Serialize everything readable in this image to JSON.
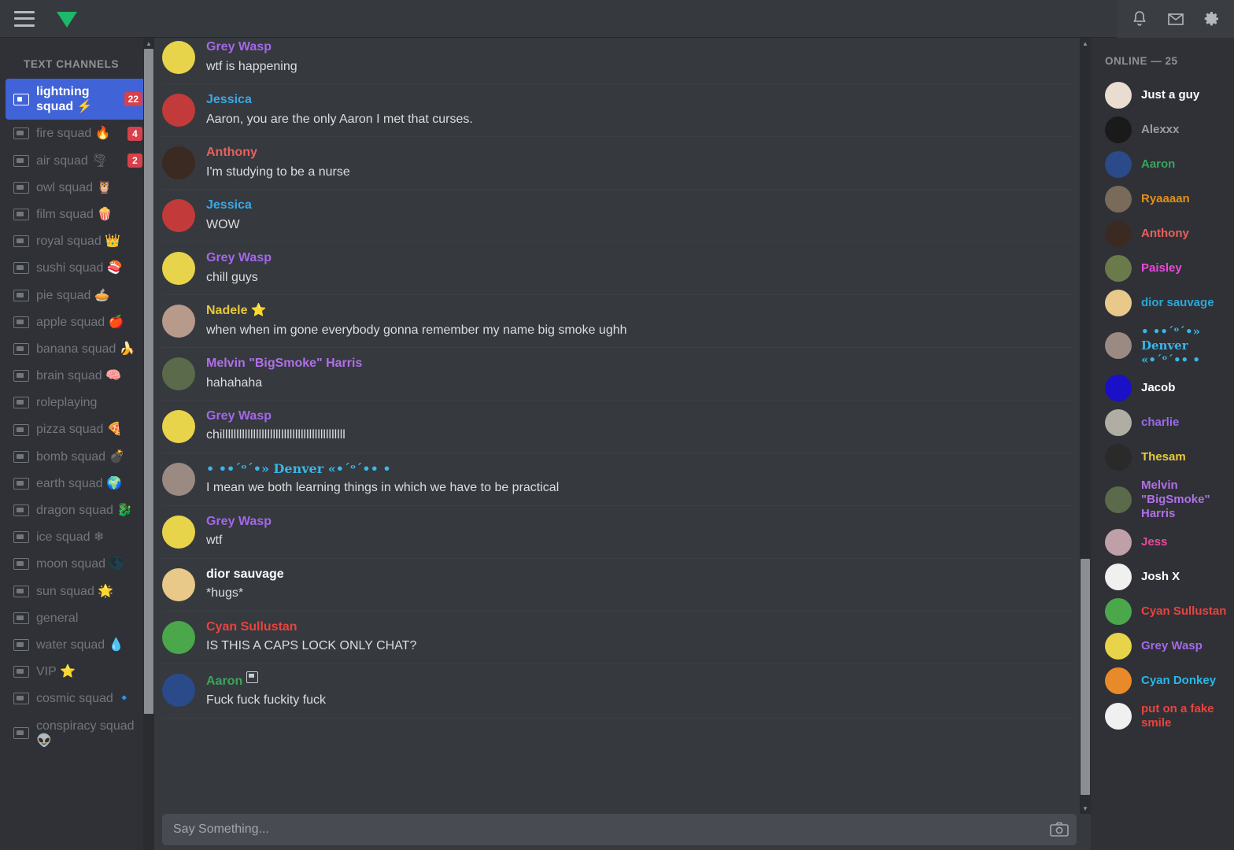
{
  "topbar": {
    "menu_icon": "hamburger-menu-icon",
    "logo_icon": "green-gem-logo",
    "notifications_icon": "bell-icon",
    "mail_icon": "envelope-icon",
    "settings_icon": "gear-icon"
  },
  "sidebar": {
    "title": "TEXT CHANNELS",
    "channels": [
      {
        "label": "lightning squad ⚡",
        "badge": "22",
        "active": true
      },
      {
        "label": "fire squad 🔥",
        "badge": "4",
        "active": false
      },
      {
        "label": "air squad 🌪",
        "badge": "2",
        "active": false
      },
      {
        "label": "owl squad 🦉",
        "badge": "",
        "active": false
      },
      {
        "label": "film squad 🍿",
        "badge": "",
        "active": false
      },
      {
        "label": "royal squad 👑",
        "badge": "",
        "active": false
      },
      {
        "label": "sushi squad 🍣",
        "badge": "",
        "active": false
      },
      {
        "label": "pie squad 🥧",
        "badge": "",
        "active": false
      },
      {
        "label": "apple squad 🍎",
        "badge": "",
        "active": false
      },
      {
        "label": "banana squad 🍌",
        "badge": "",
        "active": false
      },
      {
        "label": "brain squad 🧠",
        "badge": "",
        "active": false
      },
      {
        "label": "roleplaying",
        "badge": "",
        "active": false
      },
      {
        "label": "pizza squad 🍕",
        "badge": "",
        "active": false
      },
      {
        "label": "bomb squad 💣",
        "badge": "",
        "active": false
      },
      {
        "label": "earth squad 🌍",
        "badge": "",
        "active": false
      },
      {
        "label": "dragon squad 🐉",
        "badge": "",
        "active": false
      },
      {
        "label": "ice squad ❄",
        "badge": "",
        "active": false
      },
      {
        "label": "moon squad 🌑",
        "badge": "",
        "active": false
      },
      {
        "label": "sun squad 🌟",
        "badge": "",
        "active": false
      },
      {
        "label": "general",
        "badge": "",
        "active": false
      },
      {
        "label": "water squad 💧",
        "badge": "",
        "active": false
      },
      {
        "label": "VIP ⭐",
        "badge": "",
        "active": false
      },
      {
        "label": "cosmic squad 🔹",
        "badge": "",
        "active": false
      },
      {
        "label": "conspiracy squad 👽",
        "badge": "",
        "active": false
      }
    ]
  },
  "chat": {
    "messages": [
      {
        "user": "Grey Wasp",
        "color": "#a368e8",
        "text": "wtf is happening",
        "avatar": "#e8d44a",
        "badge": ""
      },
      {
        "user": "Jessica",
        "color": "#3aa8e8",
        "text": "Aaron, you are the only Aaron I met that curses.",
        "avatar": "#c23a3a",
        "badge": ""
      },
      {
        "user": "Anthony",
        "color": "#e8615c",
        "text": "I'm studying to be a nurse",
        "avatar": "#3a2a22",
        "badge": ""
      },
      {
        "user": "Jessica",
        "color": "#3aa8e8",
        "text": "WOW",
        "avatar": "#c23a3a",
        "badge": ""
      },
      {
        "user": "Grey Wasp",
        "color": "#a368e8",
        "text": "chill guys",
        "avatar": "#e8d44a",
        "badge": ""
      },
      {
        "user": "Nadele ⭐",
        "color": "#e8c93a",
        "text": "when when im gone everybody gonna remember my name big smoke ughh",
        "avatar": "#b79a8a",
        "badge": ""
      },
      {
        "user": "Melvin \"BigSmoke\" Harris",
        "color": "#b06fe8",
        "text": "hahahaha",
        "avatar": "#5a6a4a",
        "badge": ""
      },
      {
        "user": "Grey Wasp",
        "color": "#a368e8",
        "text": "chillllllllllllllllllllllllllllllllllllllllllll",
        "avatar": "#e8d44a",
        "badge": ""
      },
      {
        "user": "• ••ˊᵒˊ•» Denver «•ˊᵒˊ•• •",
        "color": "#3ab6e8",
        "text": "I mean we both learning things in which we have to be practical",
        "avatar": "#9a8a82",
        "badge": ""
      },
      {
        "user": "Grey Wasp",
        "color": "#a368e8",
        "text": "wtf",
        "avatar": "#e8d44a",
        "badge": ""
      },
      {
        "user": "dior sauvage",
        "color": "#ffffff",
        "text": "*hugs*",
        "avatar": "#e8c98a",
        "badge": ""
      },
      {
        "user": "Cyan Sullustan",
        "color": "#e8443f",
        "text": "IS THIS A CAPS LOCK ONLY CHAT?",
        "avatar": "#4aa84a",
        "badge": ""
      },
      {
        "user": "Aaron",
        "color": "#3ba55c",
        "text": "Fuck fuck fuckity fuck",
        "avatar": "#2a4a8a",
        "badge": "badge-icon"
      }
    ],
    "composer": {
      "placeholder": "Say Something...",
      "value": "",
      "camera_icon": "camera-icon"
    }
  },
  "members": {
    "title": "ONLINE — 25",
    "list": [
      {
        "name": "Just a guy",
        "color": "#ffffff",
        "avatar": "#e8ddd0"
      },
      {
        "name": "Alexxx",
        "color": "#9b9ea3",
        "avatar": "#1a1a1a"
      },
      {
        "name": "Aaron",
        "color": "#3ba55c",
        "avatar": "#2a4a8a"
      },
      {
        "name": "Ryaaaan",
        "color": "#e0921a",
        "avatar": "#7a6a5a"
      },
      {
        "name": "Anthony",
        "color": "#e8615c",
        "avatar": "#3a2a22"
      },
      {
        "name": "Paisley",
        "color": "#e84ad8",
        "avatar": "#6a7a4a"
      },
      {
        "name": "dior sauvage",
        "color": "#29a8d8",
        "avatar": "#e8c98a"
      },
      {
        "name": "• ••ˊᵒˊ•» Denver «•ˊᵒˊ•• •",
        "color": "#3ab6e8",
        "avatar": "#9a8a82"
      },
      {
        "name": "Jacob",
        "color": "#ffffff",
        "avatar": "#1a10c8"
      },
      {
        "name": "charlie",
        "color": "#9b6ae8",
        "avatar": "#b0ada5"
      },
      {
        "name": "Thesam",
        "color": "#e8c93a",
        "avatar": "#2a2a2a"
      },
      {
        "name": "Melvin \"BigSmoke\" Harris",
        "color": "#b06fe8",
        "avatar": "#5a6a4a"
      },
      {
        "name": "Jess",
        "color": "#e84a9a",
        "avatar": "#c0a0a8"
      },
      {
        "name": "Josh X",
        "color": "#ffffff",
        "avatar": "#f0f0f0"
      },
      {
        "name": "Cyan Sullustan",
        "color": "#e8443f",
        "avatar": "#4aa84a"
      },
      {
        "name": "Grey Wasp",
        "color": "#a368e8",
        "avatar": "#e8d44a"
      },
      {
        "name": "Cyan Donkey",
        "color": "#29b8e8",
        "avatar": "#e88a2a"
      },
      {
        "name": "put on a fake smile",
        "color": "#e8443f",
        "avatar": "#f0f0f0"
      }
    ]
  },
  "colors": {
    "accent": "#4063d8",
    "badge_red": "#d8404a",
    "chat_bg": "#36393e",
    "sidebar_bg": "#2f3136"
  }
}
